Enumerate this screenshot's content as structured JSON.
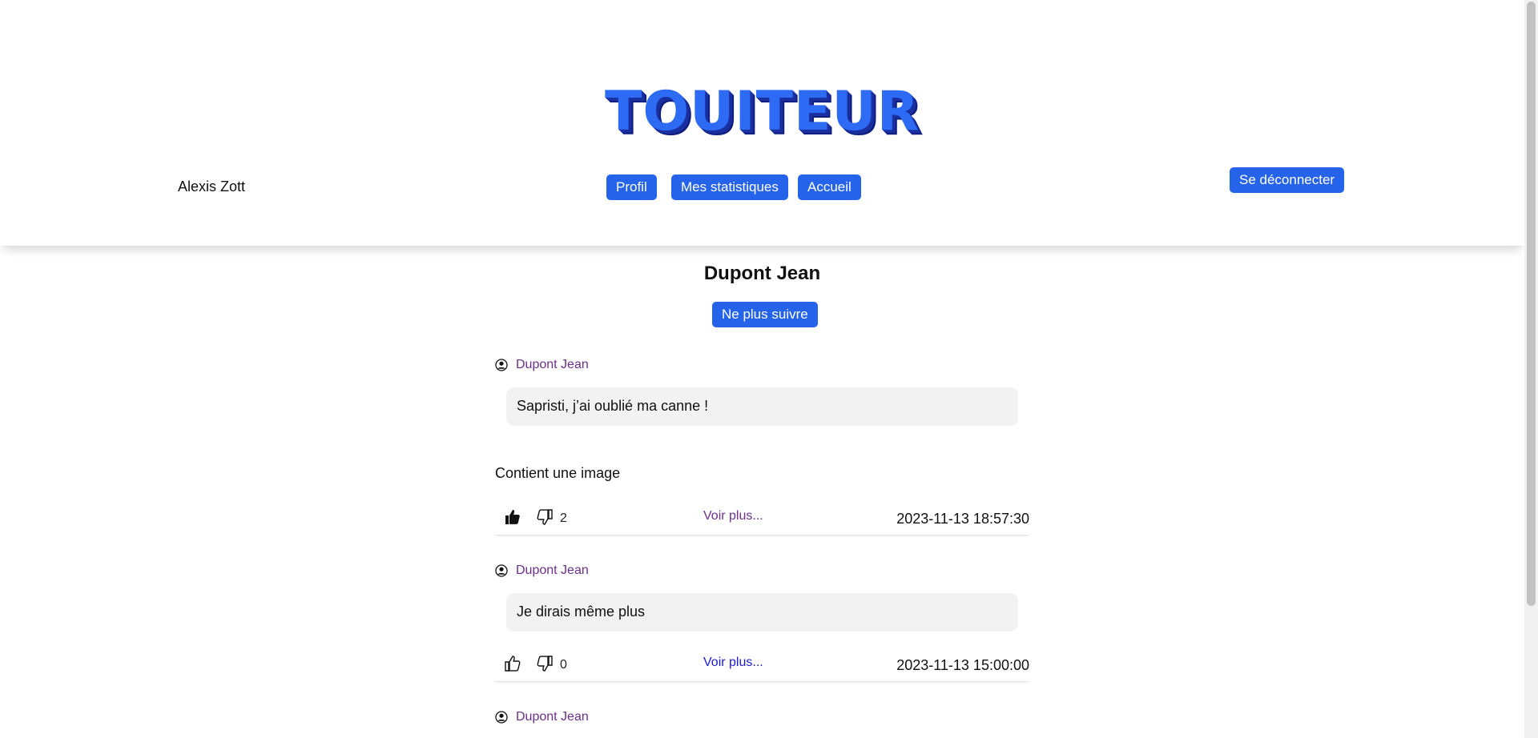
{
  "header": {
    "logo": "TOUITEUR",
    "username": "Alexis Zott",
    "nav": {
      "profil": "Profil",
      "stats": "Mes statistiques",
      "accueil": "Accueil"
    },
    "logout": "Se déconnecter"
  },
  "profile": {
    "name": "Dupont Jean",
    "unfollow": "Ne plus suivre"
  },
  "posts": [
    {
      "author": "Dupont Jean",
      "text": "Sapristi, j’ai oublié ma canne !",
      "extra": "Contient une image",
      "likes_label": "2",
      "liked": true,
      "more": "Voir plus...",
      "date": "2023-11-13 18:57:30"
    },
    {
      "author": "Dupont Jean",
      "text": "Je dirais même plus",
      "likes_label": "0",
      "liked": false,
      "more": "Voir plus...",
      "date": "2023-11-13 15:00:00"
    },
    {
      "author": "Dupont Jean"
    }
  ],
  "colors": {
    "accent": "#2563eb",
    "author": "#6b2f8c",
    "link_visited": "#6b2f8c",
    "link": "#1a1ad6",
    "bubble": "#f2f2f2"
  }
}
